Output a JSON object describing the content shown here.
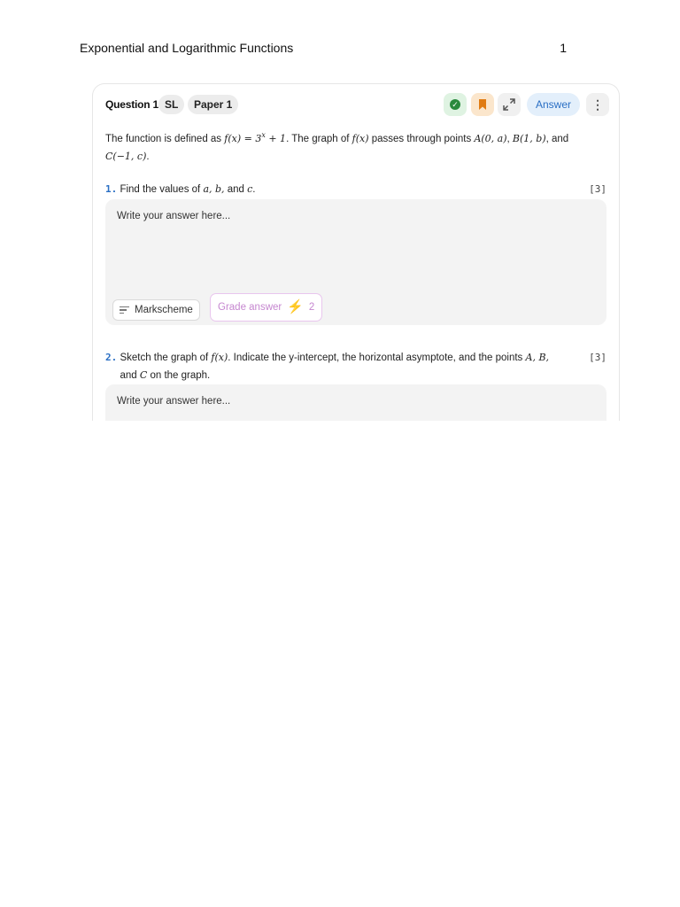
{
  "page": {
    "title": "Exponential and Logarithmic Functions",
    "number": "1"
  },
  "question": {
    "title": "Question 1",
    "level": "SL",
    "paper": "Paper 1",
    "answer_label": "Answer",
    "icons": {
      "check": "check-circle-icon",
      "bookmark": "bookmark-icon",
      "expand": "expand-icon",
      "more": "more-vertical-icon"
    },
    "colors": {
      "accent": "#2a6fc4",
      "check": "#2a8a3d",
      "bookmark": "#e07b12",
      "grade": "#c687d0"
    },
    "stem": {
      "pre": "The function is defined as ",
      "fx": "f(x) = 3",
      "exp": "x",
      "plus": " + 1",
      "mid1": ". The graph of ",
      "f2": "f(x)",
      "mid2": " passes through points ",
      "A": "A(0, a)",
      "comma1": ", ",
      "B": "B(1, b)",
      "and": ", and",
      "C": "C(−1, c)",
      "end": "."
    },
    "parts": [
      {
        "index": "1.",
        "pre": "Find the values of ",
        "vars": "a, b,",
        "and": " and ",
        "c": "c",
        "end": ".",
        "marks": "[3]",
        "placeholder": "Write your answer here...",
        "markscheme_label": "Markscheme",
        "grade_label": "Grade answer",
        "grade_count": "2"
      },
      {
        "index": "2.",
        "pre": "Sketch the graph of ",
        "f": "f(x)",
        "mid": ". Indicate the y-intercept, the horizontal asymptote, and the points ",
        "pts": "A, B,",
        "and": " and ",
        "c": "C",
        "end": " on the graph.",
        "marks": "[3]",
        "placeholder": "Write your answer here..."
      }
    ]
  }
}
